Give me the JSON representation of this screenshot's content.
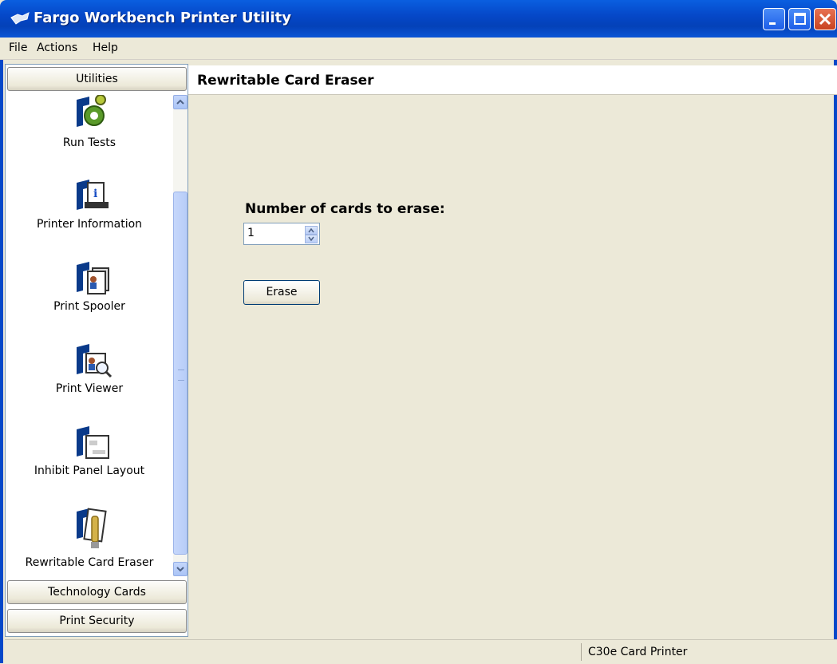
{
  "window": {
    "title": "Fargo Workbench Printer Utility"
  },
  "menu": {
    "items": [
      "File",
      "Actions",
      "Help"
    ]
  },
  "sidebar": {
    "category_top": "Utilities",
    "tools": [
      {
        "label": "Run Tests",
        "icon": "gear-icon"
      },
      {
        "label": "Printer Information",
        "icon": "printer-info-icon"
      },
      {
        "label": "Print Spooler",
        "icon": "print-spooler-icon"
      },
      {
        "label": "Print Viewer",
        "icon": "print-viewer-icon"
      },
      {
        "label": "Inhibit Panel Layout",
        "icon": "inhibit-panel-icon"
      },
      {
        "label": "Rewritable Card Eraser",
        "icon": "card-eraser-icon"
      }
    ],
    "category_bottom": [
      "Technology Cards",
      "Print Security"
    ]
  },
  "main": {
    "header": "Rewritable Card Eraser",
    "cards_label": "Number of cards to erase:",
    "cards_value": "1",
    "erase_button": "Erase"
  },
  "status": {
    "printer": "C30e Card Printer"
  }
}
